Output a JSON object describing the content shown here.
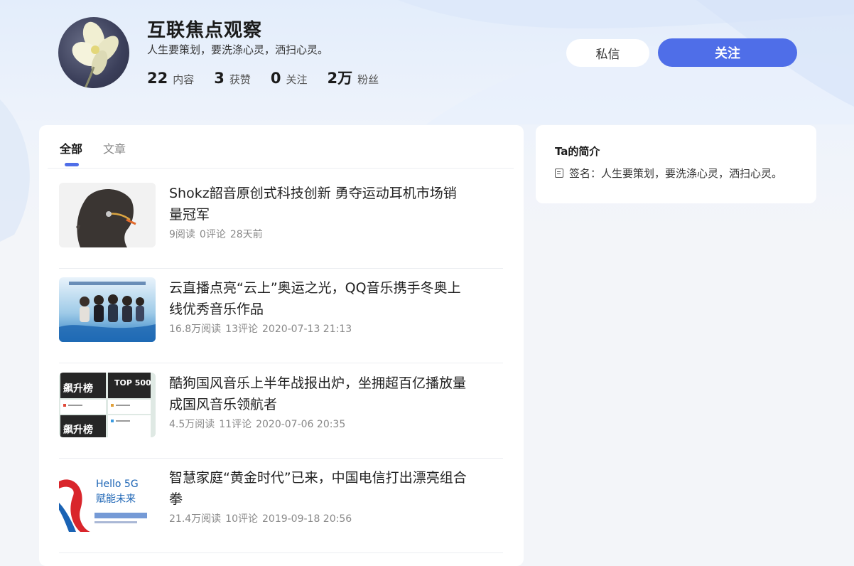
{
  "profile": {
    "name": "互联焦点观察",
    "signature": "人生要策划，要洗涤心灵，洒扫心灵。",
    "stats": [
      {
        "num": "22",
        "label": "内容"
      },
      {
        "num": "3",
        "label": "获赞"
      },
      {
        "num": "0",
        "label": "关注"
      },
      {
        "num": "2万",
        "label": "粉丝"
      }
    ]
  },
  "actions": {
    "message_label": "私信",
    "follow_label": "关注"
  },
  "tabs": [
    {
      "label": "全部",
      "active": true
    },
    {
      "label": "文章",
      "active": false
    }
  ],
  "articles": [
    {
      "title": "Shokz韶音原创式科技创新 勇夺运动耳机市场销量冠军",
      "reads": "9阅读",
      "comments": "0评论",
      "time": "28天前",
      "thumb_icon": "bone-conduction-headphone-photo"
    },
    {
      "title": "云直播点亮“云上”奥运之光，QQ音乐携手冬奥上线优秀音乐作品",
      "reads": "16.8万阅读",
      "comments": "13评论",
      "time": "2020-07-13 21:13",
      "thumb_icon": "olympic-concert-poster"
    },
    {
      "title": "酷狗国风音乐上半年战报出炉，坐拥超百亿播放量成国风音乐领航者",
      "reads": "4.5万阅读",
      "comments": "11评论",
      "time": "2020-07-06 20:35",
      "thumb_icon": "music-chart-screenshot",
      "thumb_texts": [
        "飙升榜",
        "TOP 500",
        "飙升榜"
      ]
    },
    {
      "title": "智慧家庭“黄金时代”已来，中国电信打出漂亮组合拳",
      "reads": "21.4万阅读",
      "comments": "10评论",
      "time": "2019-09-18 20:56",
      "thumb_icon": "hello-5g-banner",
      "thumb_texts": [
        "Hello 5G",
        "赋能未来"
      ]
    }
  ],
  "sidebar": {
    "title": "Ta的简介",
    "signature_row": "签名：人生要策划，要洗涤心灵，洒扫心灵。"
  },
  "colors": {
    "accent": "#4f6ee8",
    "background": "#f3f5f9"
  }
}
